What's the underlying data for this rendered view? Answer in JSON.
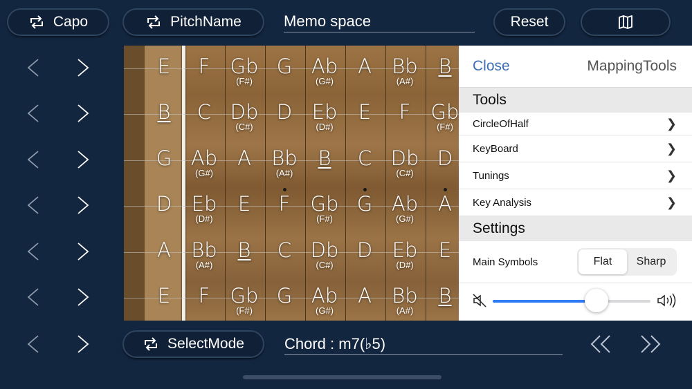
{
  "toolbar": {
    "capo_label": "Capo",
    "pitchname_label": "PitchName",
    "memo_text": "Memo space",
    "reset_label": "Reset",
    "selectmode_label": "SelectMode",
    "chord_text": "Chord : m7(♭5)"
  },
  "colors": {
    "background": "#132640",
    "accent": "#3d6fb4",
    "slider": "#2f7bf5"
  },
  "fretboard": {
    "strings": [
      [
        {
          "n": "E",
          "u": false
        },
        {
          "n": "F"
        },
        {
          "n": "Gb",
          "s": "(F#)"
        },
        {
          "n": "G"
        },
        {
          "n": "Ab",
          "s": "(G#)"
        },
        {
          "n": "A"
        },
        {
          "n": "Bb",
          "s": "(A#)"
        },
        {
          "n": "B",
          "u": true
        }
      ],
      [
        {
          "n": "B",
          "u": true
        },
        {
          "n": "C"
        },
        {
          "n": "Db",
          "s": "(C#)"
        },
        {
          "n": "D"
        },
        {
          "n": "Eb",
          "s": "(D#)"
        },
        {
          "n": "E"
        },
        {
          "n": "F"
        },
        {
          "n": "Gb",
          "s": "(F#)"
        }
      ],
      [
        {
          "n": "G"
        },
        {
          "n": "Ab",
          "s": "(G#)"
        },
        {
          "n": "A"
        },
        {
          "n": "Bb",
          "s": "(A#)"
        },
        {
          "n": "B",
          "u": true
        },
        {
          "n": "C"
        },
        {
          "n": "Db",
          "s": "(C#)"
        },
        {
          "n": "D"
        }
      ],
      [
        {
          "n": "D"
        },
        {
          "n": "Eb",
          "s": "(D#)"
        },
        {
          "n": "E"
        },
        {
          "n": "F",
          "d": true
        },
        {
          "n": "Gb",
          "s": "(F#)"
        },
        {
          "n": "G",
          "d": true
        },
        {
          "n": "Ab",
          "s": "(G#)"
        },
        {
          "n": "A",
          "d": true
        }
      ],
      [
        {
          "n": "A"
        },
        {
          "n": "Bb",
          "s": "(A#)"
        },
        {
          "n": "B",
          "u": true
        },
        {
          "n": "C"
        },
        {
          "n": "Db",
          "s": "(C#)"
        },
        {
          "n": "D"
        },
        {
          "n": "Eb",
          "s": "(D#)"
        },
        {
          "n": "E"
        }
      ],
      [
        {
          "n": "E"
        },
        {
          "n": "F"
        },
        {
          "n": "Gb",
          "s": "(F#)"
        },
        {
          "n": "G"
        },
        {
          "n": "Ab",
          "s": "(G#)"
        },
        {
          "n": "A"
        },
        {
          "n": "Bb",
          "s": "(A#)"
        },
        {
          "n": "B",
          "u": true
        }
      ]
    ]
  },
  "panel": {
    "close_label": "Close",
    "title": "MappingTools",
    "tools_header": "Tools",
    "tools": [
      "CircleOfHalf",
      "KeyBoard",
      "Tunings",
      "Key Analysis"
    ],
    "settings_header": "Settings",
    "main_symbols_label": "Main Symbols",
    "segment": [
      "Flat",
      "Sharp"
    ],
    "selected_segment": "Flat",
    "volume_level": 0.66
  }
}
